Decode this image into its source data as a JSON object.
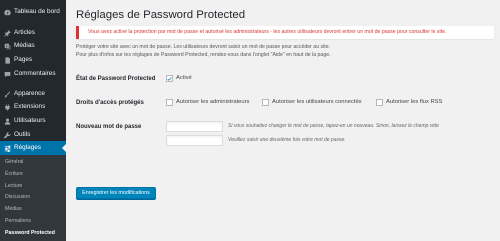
{
  "sidebar": {
    "items": [
      {
        "label": "Tableau de bord",
        "icon": "dashboard-icon"
      },
      {
        "label": "Articles",
        "icon": "pin-icon"
      },
      {
        "label": "Médias",
        "icon": "media-icon"
      },
      {
        "label": "Pages",
        "icon": "page-icon"
      },
      {
        "label": "Commentaires",
        "icon": "comment-icon"
      },
      {
        "label": "Apparence",
        "icon": "paintbrush-icon"
      },
      {
        "label": "Extensions",
        "icon": "plugin-icon"
      },
      {
        "label": "Utilisateurs",
        "icon": "users-icon"
      },
      {
        "label": "Outils",
        "icon": "wrench-icon"
      },
      {
        "label": "Réglages",
        "icon": "settings-icon",
        "current": true
      }
    ],
    "submenu": [
      "Général",
      "Écriture",
      "Lecture",
      "Discussion",
      "Médias",
      "Permaliens",
      "Password Protected"
    ],
    "submenu_current": "Password Protected"
  },
  "page": {
    "title": "Réglages de Password Protected",
    "notice": "Vous avez activé la protection par mot de passe et autorisé les administrateurs - les autres utilisateurs devront entrer un mot de passe pour consulter le site.",
    "intro_line1": "Protéger votre site avec un mot de passe. Les utilisateurs devront saisir un mot de passe pour accéder au site.",
    "intro_line2": "Pour plus d'infos sur les réglages de Password Protected, rendez-vous dans l'onglet \"Aide\" en haut de la page."
  },
  "status": {
    "label": "État de Password Protected",
    "checkbox_label": "Activé",
    "checked": true
  },
  "access": {
    "label": "Droits d'accès protégés",
    "options": [
      {
        "label": "Autoriser les administrateurs",
        "checked": false
      },
      {
        "label": "Autoriser les utilisateurs connectés",
        "checked": false
      },
      {
        "label": "Autoriser les flux RSS",
        "checked": false
      }
    ]
  },
  "new_password": {
    "label": "Nouveau mot de passe",
    "hint1": "Si vous souhaitez changer le mot de passe, tapez-en un nouveau. Sinon, laissez le champ vide",
    "hint2": "Veuillez saisir une deuxième fois votre mot de passe."
  },
  "actions": {
    "save_label": "Enregistrer les modifications"
  },
  "colors": {
    "sidebar_bg": "#23282d",
    "submenu_bg": "#32373c",
    "accent": "#0073aa",
    "button": "#0085ba",
    "notice_red": "#dc3232"
  }
}
